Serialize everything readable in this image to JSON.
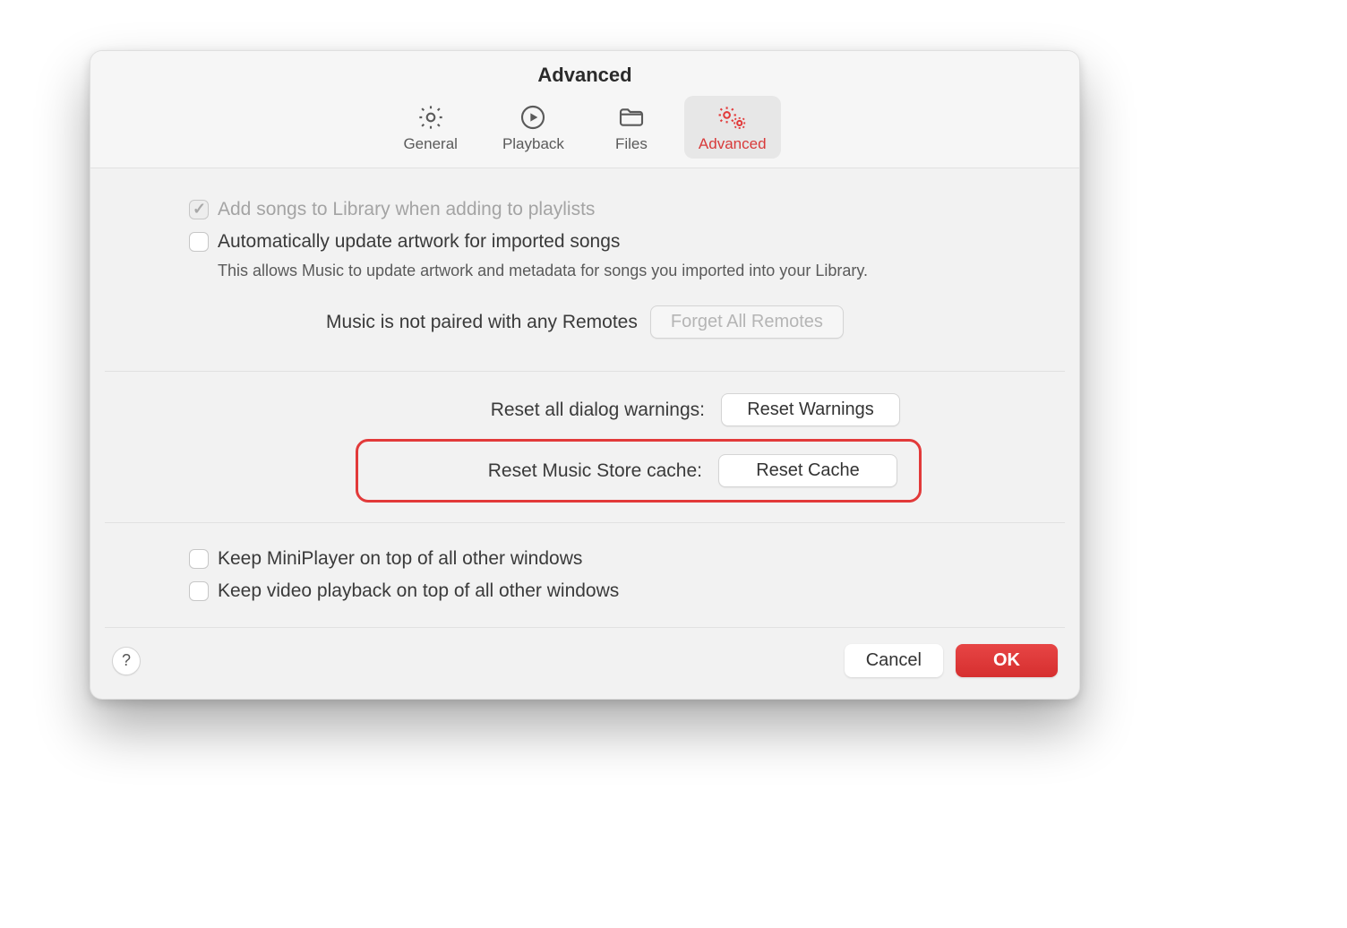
{
  "window_title": "Advanced",
  "tabs": [
    {
      "label": "General"
    },
    {
      "label": "Playback"
    },
    {
      "label": "Files"
    },
    {
      "label": "Advanced"
    }
  ],
  "options": {
    "add_to_library": {
      "label": "Add songs to Library when adding to playlists"
    },
    "auto_artwork": {
      "label": "Automatically update artwork for imported songs",
      "helper": "This allows Music to update artwork and metadata for songs you imported into your Library."
    },
    "keep_miniplayer": {
      "label": "Keep MiniPlayer on top of all other windows"
    },
    "keep_video": {
      "label": "Keep video playback on top of all other windows"
    }
  },
  "remotes": {
    "status": "Music is not paired with any Remotes",
    "forget_button": "Forget All Remotes"
  },
  "reset": {
    "warnings_label": "Reset all dialog warnings:",
    "warnings_button": "Reset Warnings",
    "cache_label": "Reset Music Store cache:",
    "cache_button": "Reset Cache"
  },
  "footer": {
    "help": "?",
    "cancel": "Cancel",
    "ok": "OK"
  }
}
